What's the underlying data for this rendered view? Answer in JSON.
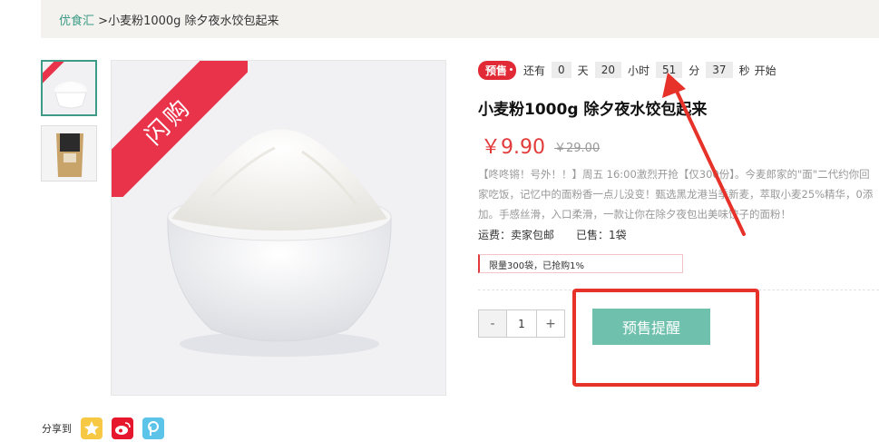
{
  "breadcrumb": {
    "home": "优食汇",
    "separator": ">",
    "current": "小麦粉1000g 除夕夜水饺包起来"
  },
  "main_image": {
    "ribbon": "闪购"
  },
  "countdown": {
    "badge": "预售",
    "prefix": "还有",
    "days": "0",
    "days_unit": "天",
    "hours": "20",
    "hours_unit": "小时",
    "minutes": "51",
    "minutes_unit": "分",
    "seconds": "37",
    "seconds_unit": "秒",
    "suffix": "开始"
  },
  "product": {
    "title": "小麦粉1000g 除夕夜水饺包起来",
    "price": "￥9.90",
    "original_price": "￥29.00",
    "description": "【咚咚锵！号外！！】周五 16:00激烈开抢【仅300份】。今麦郎家的\"面\"二代约你回家吃饭，记忆中的面粉香一点儿没变！甄选黑龙港当季新麦，萃取小麦25%精华，0添加。手感丝滑，入口柔滑，一款让你在除夕夜包出美味饺子的面粉！",
    "shipping": "运费：卖家包邮",
    "sold": "已售：1袋",
    "limit": "限量300袋，已抢购1%"
  },
  "quantity": {
    "minus": "-",
    "value": "1",
    "plus": "+"
  },
  "remind_button": "预售提醒",
  "share": {
    "label": "分享到"
  },
  "colors": {
    "accent_green": "#6fc1ad",
    "price_red": "#e23b3b",
    "badge_red": "#e12a35",
    "annotation_red": "#e63229"
  }
}
